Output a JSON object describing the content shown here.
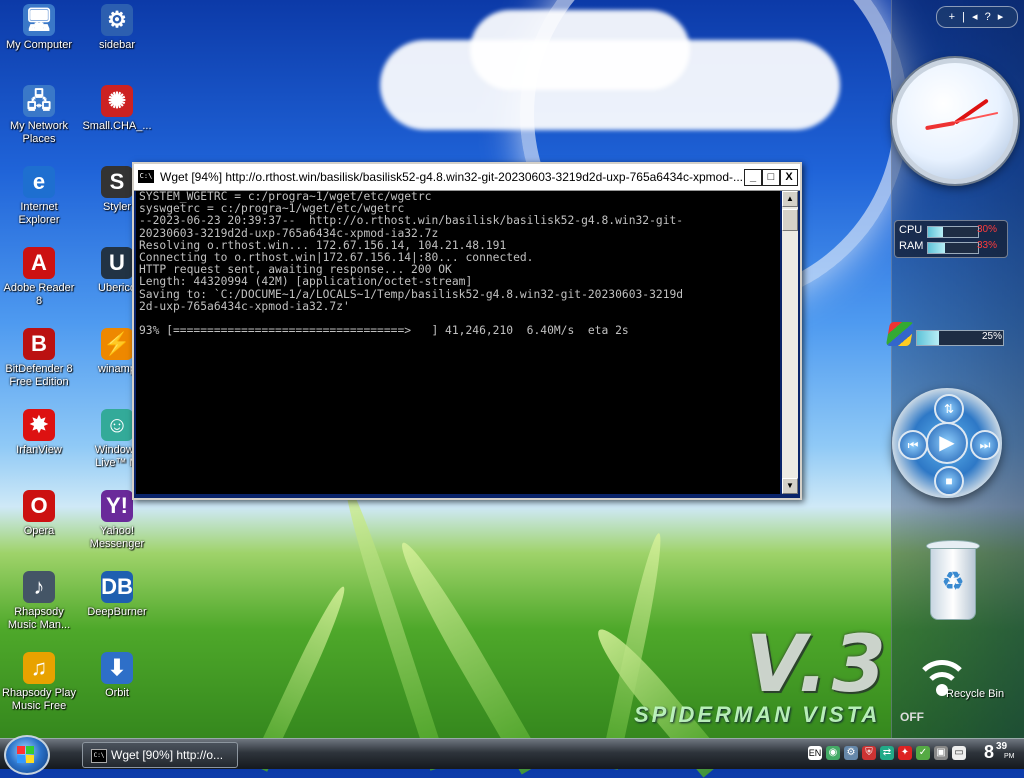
{
  "desktop_icons": [
    {
      "id": "my-computer",
      "label": "My Computer",
      "glyph": "🖥"
    },
    {
      "id": "sidebar",
      "label": "sidebar",
      "glyph": "⚙"
    },
    {
      "id": "my-network-places",
      "label": "My Network\nPlaces",
      "glyph": "🖧"
    },
    {
      "id": "small-cha",
      "label": "Small.CHA_...",
      "glyph": "✺"
    },
    {
      "id": "internet-explorer",
      "label": "Internet\nExplorer",
      "glyph": "e"
    },
    {
      "id": "styler",
      "label": "Styler",
      "glyph": "S"
    },
    {
      "id": "adobe-reader",
      "label": "Adobe Reader\n8",
      "glyph": "A"
    },
    {
      "id": "uberico",
      "label": "Uberico",
      "glyph": "U"
    },
    {
      "id": "bitdefender",
      "label": "BitDefender 8\nFree Edition",
      "glyph": "B"
    },
    {
      "id": "winamp",
      "label": "winamp",
      "glyph": "⚡"
    },
    {
      "id": "irfanview",
      "label": "IrfanView",
      "glyph": "✸"
    },
    {
      "id": "windows-live",
      "label": "Windows\nLive™ M",
      "glyph": "☺"
    },
    {
      "id": "opera",
      "label": "Opera",
      "glyph": "O"
    },
    {
      "id": "yahoo-messenger",
      "label": "Yahoo!\nMessenger",
      "glyph": "Y!"
    },
    {
      "id": "rhapsody-manager",
      "label": "Rhapsody\nMusic Man...",
      "glyph": "♪"
    },
    {
      "id": "deepburner",
      "label": "DeepBurner",
      "glyph": "DB"
    },
    {
      "id": "rhapsody-play",
      "label": "Rhapsody Play\nMusic Free",
      "glyph": "♫"
    },
    {
      "id": "orbit",
      "label": "Orbit",
      "glyph": "⬇"
    }
  ],
  "sidebar": {
    "nav_label": "+ | ◂ ? ▸",
    "cpu": {
      "label": "CPU",
      "value": "30%",
      "level": 0.3
    },
    "ram": {
      "label": "RAM",
      "value": "33%",
      "level": 0.33
    },
    "volume": {
      "value": "25%",
      "level": 0.25
    },
    "media": {
      "play": "▶",
      "prev": "⏮",
      "next": "⏭",
      "stop": "■",
      "top": "⇅"
    }
  },
  "recycle_bin": {
    "label": "Recycle Bin"
  },
  "branding": {
    "version": "V.3",
    "name": "SPIDERMAN VISTA",
    "off": "OFF"
  },
  "console_window": {
    "icon_text": "C:\\",
    "title": "Wget [94%] http://o.rthost.win/basilisk/basilisk52-g4.8.win32-git-20230603-3219d2d-uxp-765a6434c-xpmod-...",
    "minimize": "_",
    "maximize": "□",
    "close": "X",
    "lines": [
      "SYSTEM_WGETRC = c:/progra~1/wget/etc/wgetrc",
      "syswgetrc = c:/progra~1/wget/etc/wgetrc",
      "--2023-06-23 20:39:37--  http://o.rthost.win/basilisk/basilisk52-g4.8.win32-git-",
      "20230603-3219d2d-uxp-765a6434c-xpmod-ia32.7z",
      "Resolving o.rthost.win... 172.67.156.14, 104.21.48.191",
      "Connecting to o.rthost.win|172.67.156.14|:80... connected.",
      "HTTP request sent, awaiting response... 200 OK",
      "Length: 44320994 (42M) [application/octet-stream]",
      "Saving to: `C:/DOCUME~1/a/LOCALS~1/Temp/basilisk52-g4.8.win32-git-20230603-3219d",
      "2d-uxp-765a6434c-xpmod-ia32.7z'",
      "",
      "93% [==================================>   ] 41,246,210  6.40M/s  eta 2s"
    ]
  },
  "taskbar": {
    "task_label": "Wget [90%] http://o...",
    "task_icon": "C:\\",
    "tray_lang": "EN",
    "clock": "8",
    "clock_min": "39",
    "clock_ampm": "PM"
  }
}
